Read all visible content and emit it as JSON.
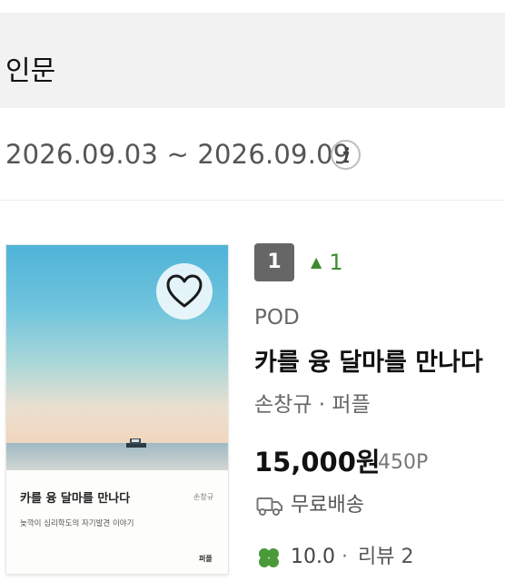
{
  "category": {
    "title": "인문"
  },
  "period": {
    "date_range": "2026.09.03 ~ 2026.09.09",
    "info_icon": "info-icon"
  },
  "book": {
    "rank": "1",
    "rank_change": "1",
    "rank_change_direction": "up",
    "format": "POD",
    "title": "카를 융 달마를 만나다",
    "author_publisher": "손창규 · 퍼플",
    "price": "15,000원",
    "points": "450P",
    "shipping": "무료배송",
    "rating": "10.0",
    "rating_separator": "·",
    "reviews": "리뷰 2",
    "wishlist_icon": "heart-icon",
    "cover": {
      "title": "카를 융 달마를 만나다",
      "author": "손창규",
      "subtitle": "늦깍이 심리학도의 자기발견 이야기",
      "publisher": "퍼플"
    }
  },
  "colors": {
    "rank_up": "#3d8b2f",
    "rank_badge": "#666666",
    "header_bg": "#f2f2f2"
  }
}
